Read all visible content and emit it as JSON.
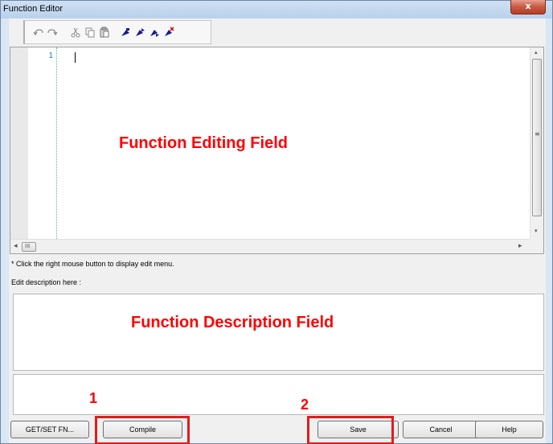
{
  "window": {
    "title": "Function Editor",
    "close_glyph": "x"
  },
  "toolbar": {
    "icons": [
      "undo-icon",
      "redo-icon",
      "cut-icon",
      "copy-icon",
      "paste-icon",
      "bookmark-toggle-icon",
      "bookmark-next-icon",
      "bookmark-previous-icon",
      "bookmark-clear-icon"
    ]
  },
  "editor": {
    "line_numbers": [
      "1"
    ],
    "overlay_label": "Function Editing Field",
    "scroll_left_label": "◂",
    "scroll_right_label": "▸",
    "scroll_up_label": "▴",
    "scroll_down_label": "▾",
    "hthumb_label": "III",
    "vthumb_label": "≡"
  },
  "hint_text": "* Click the right mouse button to display edit menu.",
  "description": {
    "label": "Edit description here :",
    "overlay_label": "Function Description Field"
  },
  "buttons": {
    "getset": "GET/SET FN...",
    "compile": "Compile",
    "save": "Save",
    "cancel": "Cancel",
    "help": "Help"
  },
  "annotations": {
    "compile_number": "1",
    "save_number": "2",
    "color": "#ff0000"
  }
}
